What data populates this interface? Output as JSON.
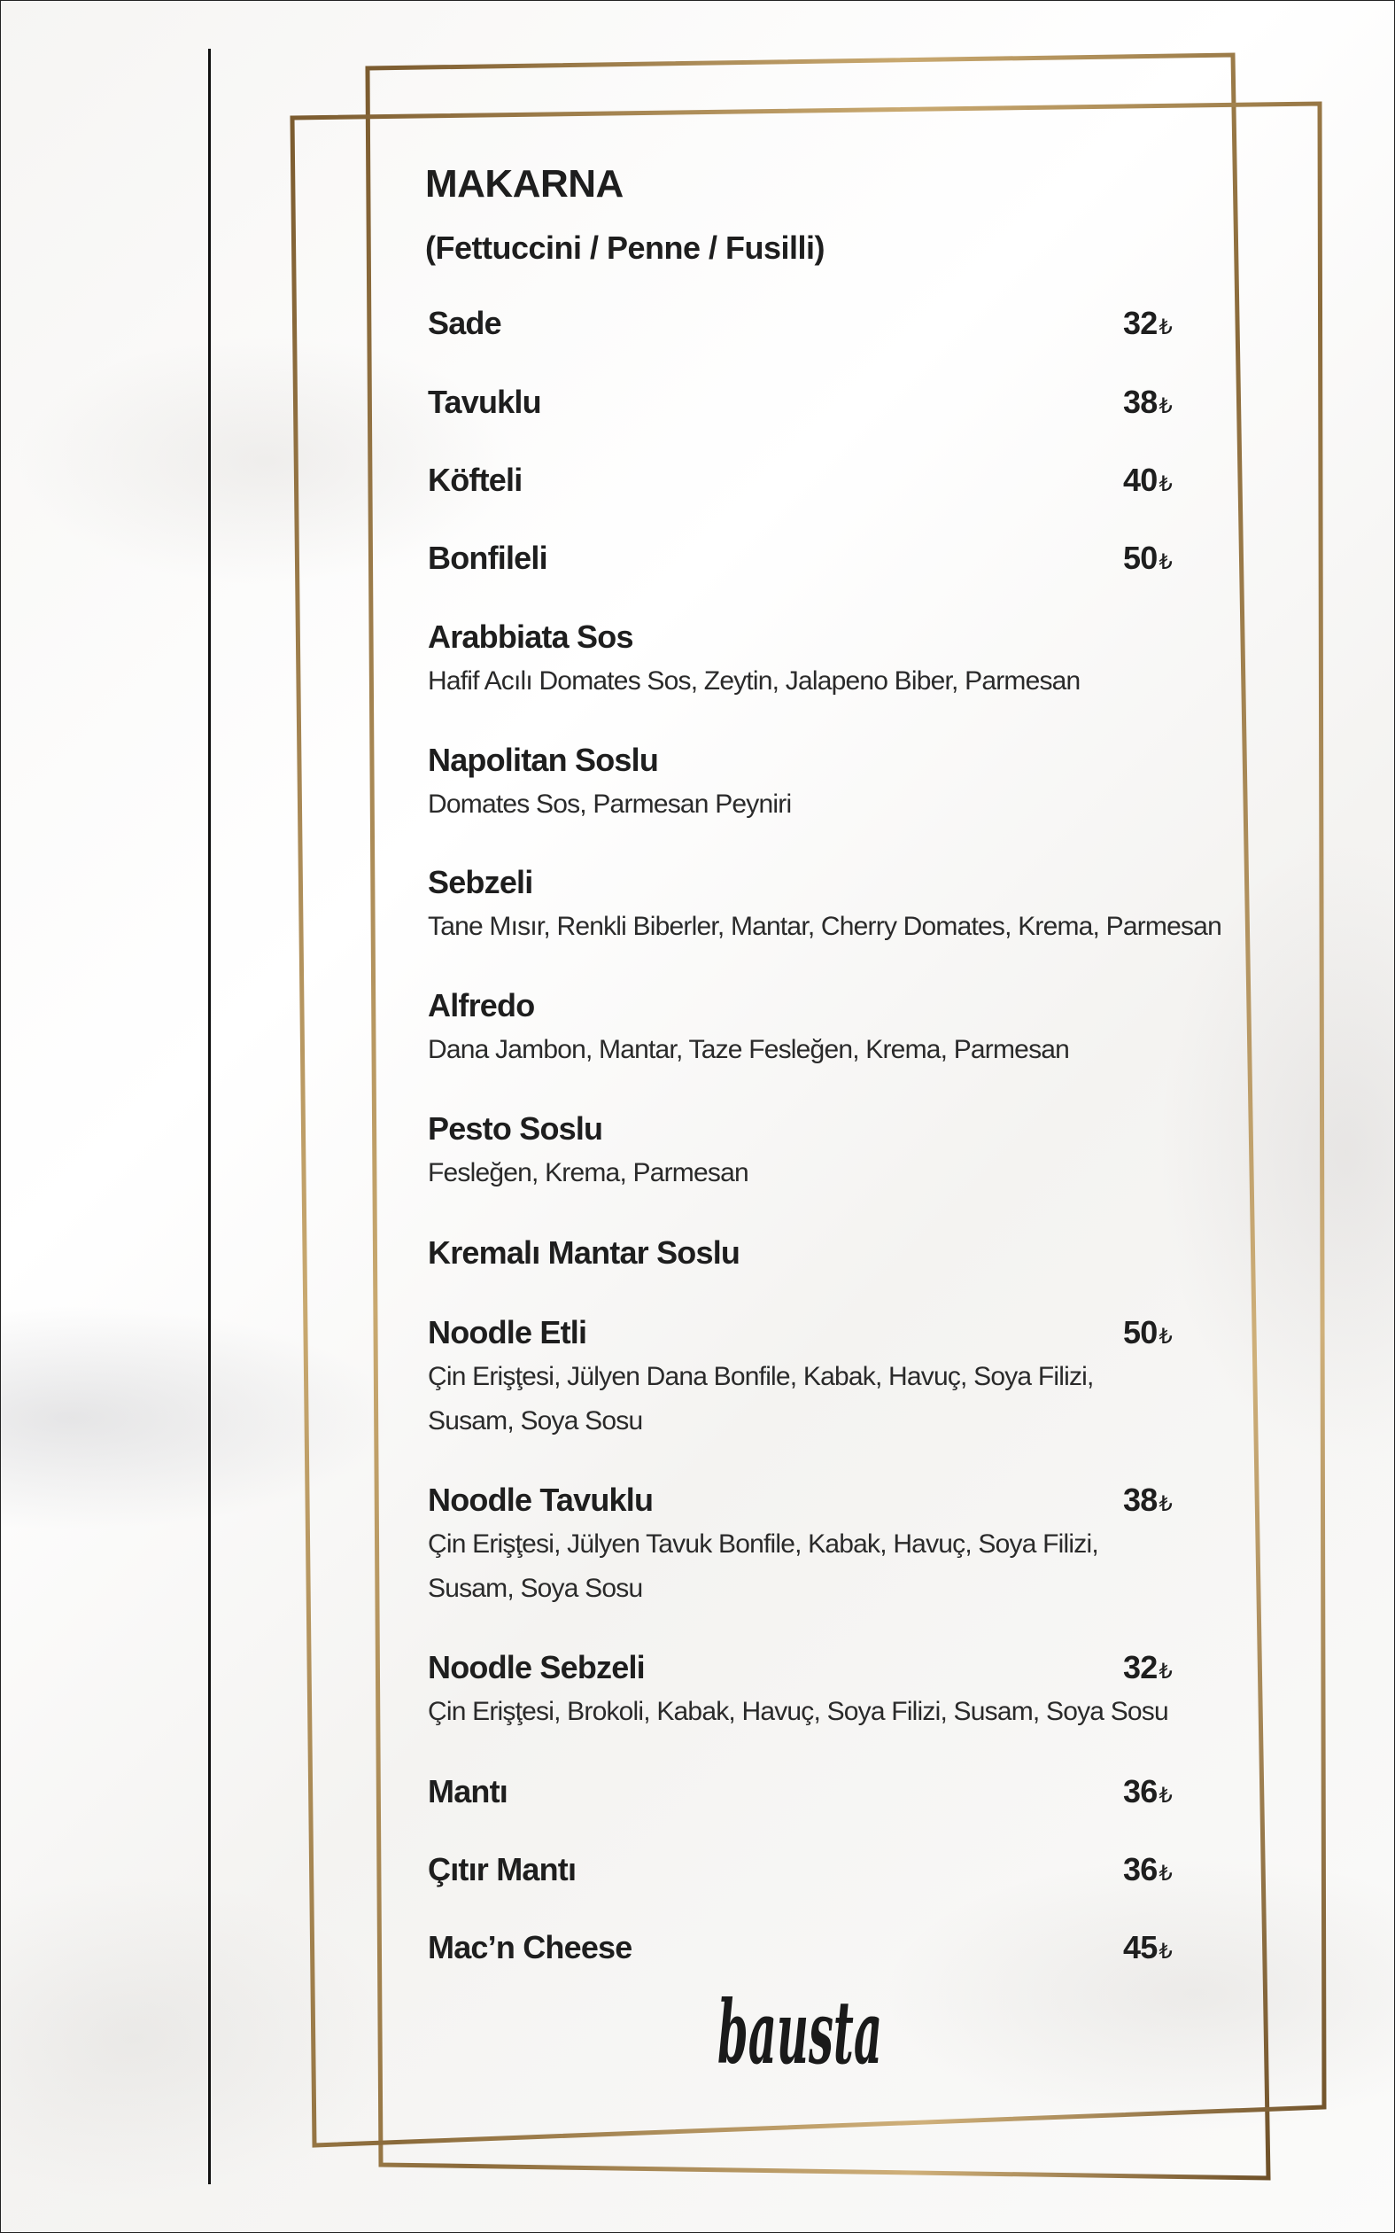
{
  "menu": {
    "title": "MAKARNA",
    "subtitle": "(Fettuccini / Penne / Fusilli)",
    "currency_symbol": "₺",
    "items": [
      {
        "name": "Sade",
        "price": "32",
        "desc": []
      },
      {
        "name": "Tavuklu",
        "price": "38",
        "desc": []
      },
      {
        "name": "Köfteli",
        "price": "40",
        "desc": []
      },
      {
        "name": "Bonfileli",
        "price": "50",
        "desc": []
      },
      {
        "name": "Arabbiata Sos",
        "price": "",
        "desc": [
          "Hafif Acılı Domates Sos, Zeytin, Jalapeno Biber, Parmesan"
        ]
      },
      {
        "name": "Napolitan Soslu",
        "price": "",
        "desc": [
          "Domates Sos, Parmesan Peyniri"
        ]
      },
      {
        "name": "Sebzeli",
        "price": "",
        "desc": [
          "Tane Mısır, Renkli Biberler, Mantar, Cherry Domates, Krema, Parmesan"
        ]
      },
      {
        "name": "Alfredo",
        "price": "",
        "desc": [
          "Dana Jambon, Mantar, Taze Fesleğen, Krema, Parmesan"
        ]
      },
      {
        "name": "Pesto Soslu",
        "price": "",
        "desc": [
          "Fesleğen, Krema, Parmesan"
        ]
      },
      {
        "name": "Kremalı Mantar Soslu",
        "price": "",
        "desc": []
      },
      {
        "name": "Noodle Etli",
        "price": "50",
        "desc": [
          "Çin Erişţesi, Jülyen Dana Bonfile, Kabak, Havuç, Soya Filizi,",
          "Susam, Soya Sosu"
        ]
      },
      {
        "name": "Noodle Tavuklu",
        "price": "38",
        "desc": [
          "Çin Erişţesi, Jülyen Tavuk Bonfile, Kabak, Havuç, Soya Filizi,",
          "Susam, Soya Sosu"
        ]
      },
      {
        "name": "Noodle Sebzeli",
        "price": "32",
        "desc": [
          "Çin Erişţesi, Brokoli, Kabak, Havuç, Soya Filizi, Susam, Soya Sosu"
        ]
      },
      {
        "name": "Mantı",
        "price": "36",
        "desc": []
      },
      {
        "name": "Çıtır Mantı",
        "price": "36",
        "desc": []
      },
      {
        "name": "Mac’n Cheese",
        "price": "45",
        "desc": []
      }
    ]
  },
  "logo": {
    "text": "bausta"
  },
  "colors": {
    "frame_gold": "#a8874f",
    "text": "#1e1e1e"
  }
}
